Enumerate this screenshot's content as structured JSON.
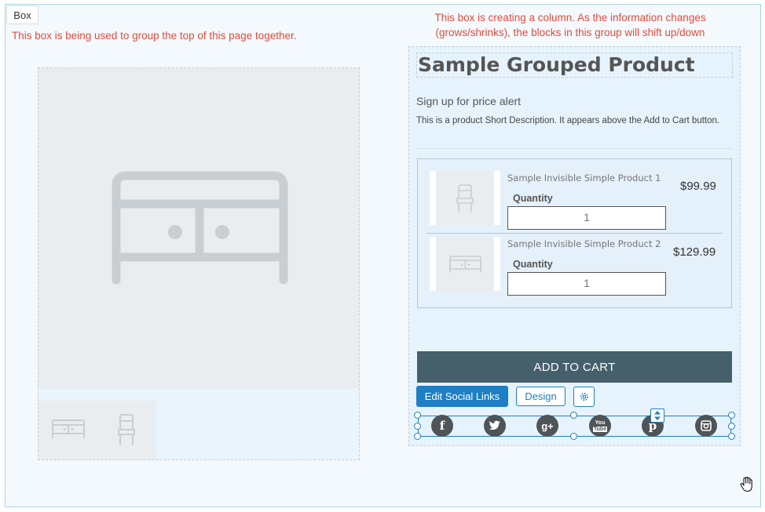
{
  "box_tag": "Box",
  "notes": {
    "left": "This box is being used to group the top of this page together.",
    "right_line1": "This box is creating a column. As the information changes",
    "right_line2": "(grows/shrinks), the blocks in this group will shift up/down"
  },
  "product": {
    "title": "Sample Grouped Product",
    "price_alert": "Sign up for price alert",
    "short_description": "This is a product Short Description. It appears above the Add to Cart button."
  },
  "items": [
    {
      "name": "Sample Invisible Simple Product 1",
      "quantity_label": "Quantity",
      "quantity": "1",
      "price": "$99.99",
      "icon": "chair-icon"
    },
    {
      "name": "Sample Invisible Simple Product 2",
      "quantity_label": "Quantity",
      "quantity": "1",
      "price": "$129.99",
      "icon": "cabinet-icon"
    }
  ],
  "buttons": {
    "add_to_cart": "ADD TO CART",
    "edit_social": "Edit Social Links",
    "design": "Design"
  },
  "social_icons": [
    "facebook-icon",
    "twitter-icon",
    "google-plus-icon",
    "youtube-icon",
    "pinterest-icon",
    "instagram-icon"
  ],
  "social_glyphs": {
    "facebook": "f",
    "google_plus": "g+",
    "youtube_top": "You",
    "youtube_bottom": "Tube",
    "pinterest": "p"
  },
  "colors": {
    "accent": "#1e7fc4",
    "note": "#e24b3b",
    "cart": "#455f6b"
  }
}
